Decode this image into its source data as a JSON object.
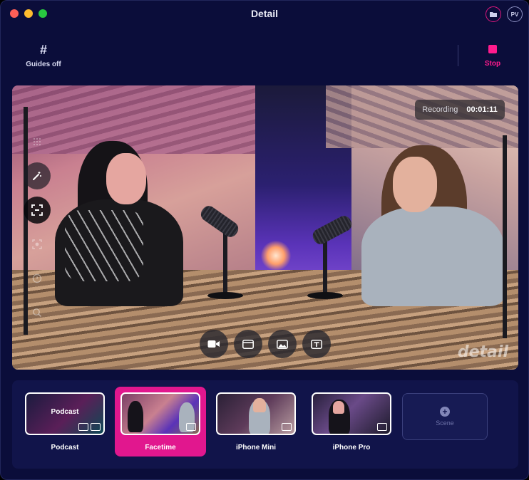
{
  "window": {
    "title": "Detail"
  },
  "titlebar": {
    "avatar_initials": "PV",
    "folder_icon": "folder-icon"
  },
  "toolbar": {
    "guides_label": "Guides off",
    "guides_icon": "hash-icon",
    "stop_label": "Stop",
    "stop_color": "#ff1b8d"
  },
  "preview": {
    "recording_label": "Recording",
    "recording_time": "00:01:11",
    "watermark": "detail",
    "side_tools": [
      "grid-icon",
      "magic-wand-icon",
      "crop-frame-icon",
      "face-frame-icon",
      "timer-icon",
      "zoom-icon"
    ],
    "bottom_tools": [
      "camera-icon",
      "window-icon",
      "image-icon",
      "text-icon"
    ]
  },
  "scenes": [
    {
      "name": "Podcast",
      "thumb_title": "Podcast",
      "active": false
    },
    {
      "name": "Facetime",
      "active": true
    },
    {
      "name": "iPhone Mini",
      "active": false
    },
    {
      "name": "iPhone Pro",
      "active": false
    }
  ],
  "add_scene": {
    "label": "Scene"
  },
  "colors": {
    "background": "#0b0d3a",
    "accent": "#e1178e",
    "strip": "#11144a"
  }
}
